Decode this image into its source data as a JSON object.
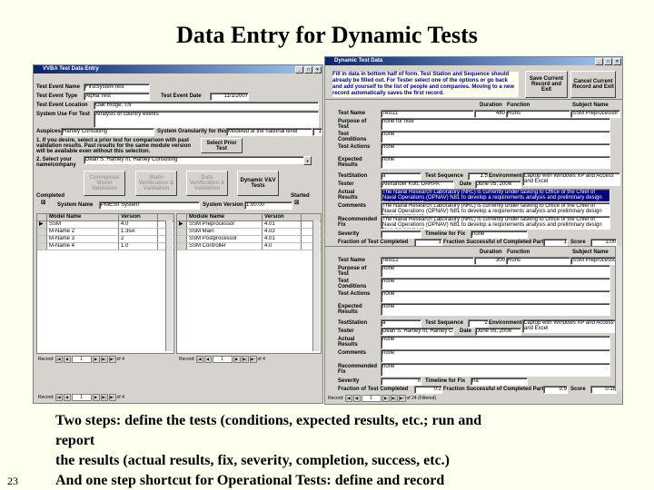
{
  "slide": {
    "title": "Data Entry for Dynamic Tests",
    "caption_lines": [
      "Two steps:  define the tests (conditions, expected results, etc.; run and",
      "report",
      "the results (actual results, fix, severity, completion, success, etc.)",
      "And one step shortcut for Operational Tests:  define and record"
    ],
    "page_number": "23"
  },
  "left": {
    "title": "VVBA Test Data Entry",
    "labels": {
      "name": "Test Event Name",
      "type": "Test Event Type",
      "date": "Test Event Date",
      "location": "Test Event Location",
      "use": "System Use For Test",
      "auspices": "Auspices",
      "granularity": "System Granularity for this Use",
      "step1": "1. If you desire, select a prior test for comparison with past validation results. Past results for the same module version will be available even without this selection.",
      "step2": "2. Select your name/company",
      "completed": "Completed",
      "started": "Started",
      "system_name": "System Name",
      "system_version": "System Version"
    },
    "values": {
      "name": "FirstSystemTest",
      "type": "Alpha Test",
      "date": "11/1/2007",
      "location": "Oak Ridge, TN",
      "use": "Analysis of country events",
      "auspices": "Hartley Consulting",
      "granularity": "Modeled at the national level",
      "granularity_num": "1",
      "step2": "Dean S. Hartley III, Hartley Consulting",
      "system_name": "PMESII System",
      "system_version": "1.00.00"
    },
    "buttons": {
      "select_prior": "Select Prior Test",
      "conceptual": "Conceptual Model Validation",
      "static": "Static Verification & Validation",
      "data": "Data Verification & Validation",
      "dynamic": "Dynamic V&V Tests"
    },
    "model_grid": {
      "headers": [
        "Model Name",
        "Version"
      ],
      "rows": [
        [
          "SSM",
          "4.0"
        ],
        [
          "M-Name 2",
          "1.35A"
        ],
        [
          "M-Name 3",
          "2"
        ],
        [
          "M-Name 4",
          "1.0"
        ]
      ]
    },
    "module_grid": {
      "headers": [
        "Module Name",
        "Version"
      ],
      "rows": [
        [
          "SSM Preprocessor",
          "4.01"
        ],
        [
          "SSM Main",
          "4.03"
        ],
        [
          "SSM Postprocessor",
          "4.01"
        ],
        [
          "SSM Controller",
          "4.0"
        ]
      ]
    },
    "nav1": {
      "label": "Record:",
      "current": "1",
      "of": "of 4"
    },
    "nav2": {
      "label": "Record:",
      "current": "1",
      "of": "of 4"
    },
    "nav3": {
      "label": "Record:",
      "current": "1",
      "of": "of 4"
    }
  },
  "right": {
    "title": "Dynamic Test Data",
    "instructions": "Fill in data in bottom half of form. Test Station and Sequence should already be filled out. For Tester select one of the options or go back and add yourself to the list of people and companies. Moving to a new record automatically saves the first record.",
    "buttons": {
      "save": "Save Current Record and Exit",
      "cancel": "Cancel Current Record and Exit"
    },
    "col_headers": {
      "duration": "Duration",
      "function": "Function",
      "subject": "Subject Name"
    },
    "labels": {
      "test_name": "Test Name",
      "purpose": "Purpose of Test",
      "conditions": "Test Conditions",
      "actions": "Test Actions",
      "expected": "Expected Results",
      "station": "TestStation",
      "sequence": "Test Sequence",
      "environment": "Environment",
      "tester": "Tester",
      "date": "Date",
      "actual": "Actual Results",
      "comments": "Comments",
      "recommended": "Recommended Fix",
      "severity": "Severity",
      "timeline": "Timeline for Fix",
      "fraction_completed": "Fraction of Test Completed",
      "fraction_success": "Fraction Successful of Completed Part",
      "score": "Score"
    },
    "rec1": {
      "test_name": "Test11",
      "duration": "480",
      "function": "Runs",
      "subject": "SSM Preprocessor",
      "purpose": "none for now",
      "conditions": "none",
      "actions": "none",
      "expected": "none",
      "station": "a",
      "sequence": "1.5",
      "environment": "Laptop with Windows XP and Access and Excel",
      "tester": "Alexander Kott, DARPA",
      "date": "June 05, 2008",
      "actual": "The Naval Research Laboratory (NRL) is currently under tasking to Office of the Chief of Naval Operations (OPNAV) N81 to develop a requirements analysis and preliminary design for a government",
      "comments": "The Naval Research Laboratory (NRL) is currently under tasking to Office of the Chief of Naval Operations (OPNAV) N81 to develop a requirements analysis and preliminary design for a government",
      "recommended": "The Naval Research Laboratory (NRL) is currently under tasking to Office of the Chief of Naval Operations (OPNAV) N81 to develop a requirements analysis and preliminary design for a government",
      "severity": "",
      "timeline": "none",
      "fraction_completed": "1",
      "fraction_success": "1",
      "score": "1.00"
    },
    "rec2": {
      "test_name": "Test12",
      "duration": "300",
      "function": "Runs",
      "subject": "SSM Preprocessor",
      "purpose": "none",
      "conditions": "none",
      "actions": "none",
      "expected": "none",
      "station": "a",
      "sequence": "2",
      "environment": "Laptop with Windows XP and Access and Excel",
      "tester": "Dean S. Hartley III, Hartley Consultin",
      "date": "June 05, 2008",
      "actual": "none",
      "comments": "none",
      "recommended": "none",
      "severity": "0",
      "timeline": "na",
      "fraction_completed": "0.2",
      "fraction_success": "0.9",
      "score": "0.18"
    },
    "nav": {
      "label": "Record:",
      "current": "1",
      "of": "of 24 (Filtered)"
    }
  }
}
